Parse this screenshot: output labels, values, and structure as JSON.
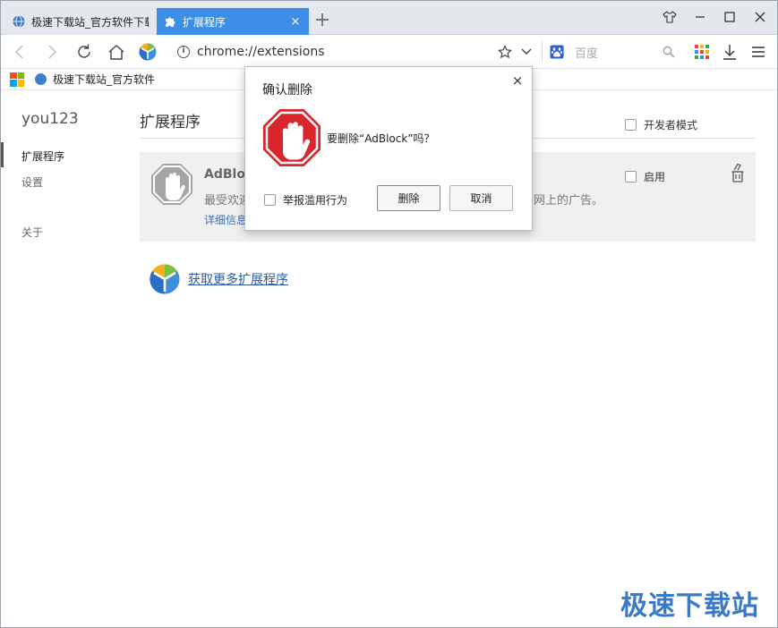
{
  "tabs": [
    {
      "title": "极速下载站_官方软件下载",
      "active": false
    },
    {
      "title": "扩展程序",
      "active": true,
      "close": "×"
    }
  ],
  "toolbar": {
    "url": "chrome://extensions",
    "search_placeholder": "百度"
  },
  "bookmarks": {
    "items": [
      {
        "label": "极速下载站_官方软件"
      }
    ]
  },
  "sidebar": {
    "user": "you123",
    "items": [
      {
        "label": "扩展程序",
        "selected": true
      },
      {
        "label": "设置",
        "selected": false
      },
      {
        "label": "关于",
        "selected": false
      }
    ]
  },
  "main": {
    "title": "扩展程序",
    "developer_mode_label": "开发者模式",
    "extension": {
      "name": "AdBlock",
      "description_head": "最受欢迎",
      "description_tail": "网上的广告。",
      "details_link": "详细信息",
      "enable_label": "启用"
    },
    "get_more_label": "获取更多扩展程序"
  },
  "dialog": {
    "title": "确认删除",
    "close": "×",
    "message": "要删除“AdBlock”吗？",
    "report_label": "举报滥用行为",
    "delete_button": "删除",
    "cancel_button": "取消"
  },
  "watermark": "极速下载站",
  "colors": {
    "active_tab": "#3c8ee6",
    "link": "#2c5aa0",
    "stop_red": "#d9262c"
  }
}
